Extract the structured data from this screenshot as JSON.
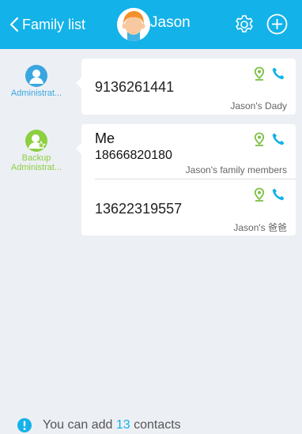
{
  "header": {
    "back_label": "Family list",
    "user_name": "Jason",
    "background": "#13b2e8",
    "icons": {
      "back": "chevron-left-icon",
      "avatar": "boy-avatar-icon",
      "settings": "gear-icon",
      "add": "plus-circle-icon"
    }
  },
  "roles": {
    "admin_label": "Administrat...",
    "backup_label_line1": "Backup",
    "backup_label_line2": "Administrat...",
    "admin_color": "#3aa6e0",
    "backup_color": "#8ccf3f"
  },
  "contacts": {
    "admin": {
      "phone": "9136261441",
      "relation": "Jason's Dady"
    },
    "backup": [
      {
        "name": "Me",
        "phone": "18666820180",
        "relation": "Jason's family members"
      },
      {
        "phone": "13622319557",
        "relation": "Jason's 爸爸"
      }
    ],
    "icons": {
      "location": "location-pin-icon",
      "call": "phone-icon"
    }
  },
  "footer": {
    "text_before": "You can add",
    "count": "13",
    "text_after": "contacts",
    "icon": "info-icon"
  }
}
